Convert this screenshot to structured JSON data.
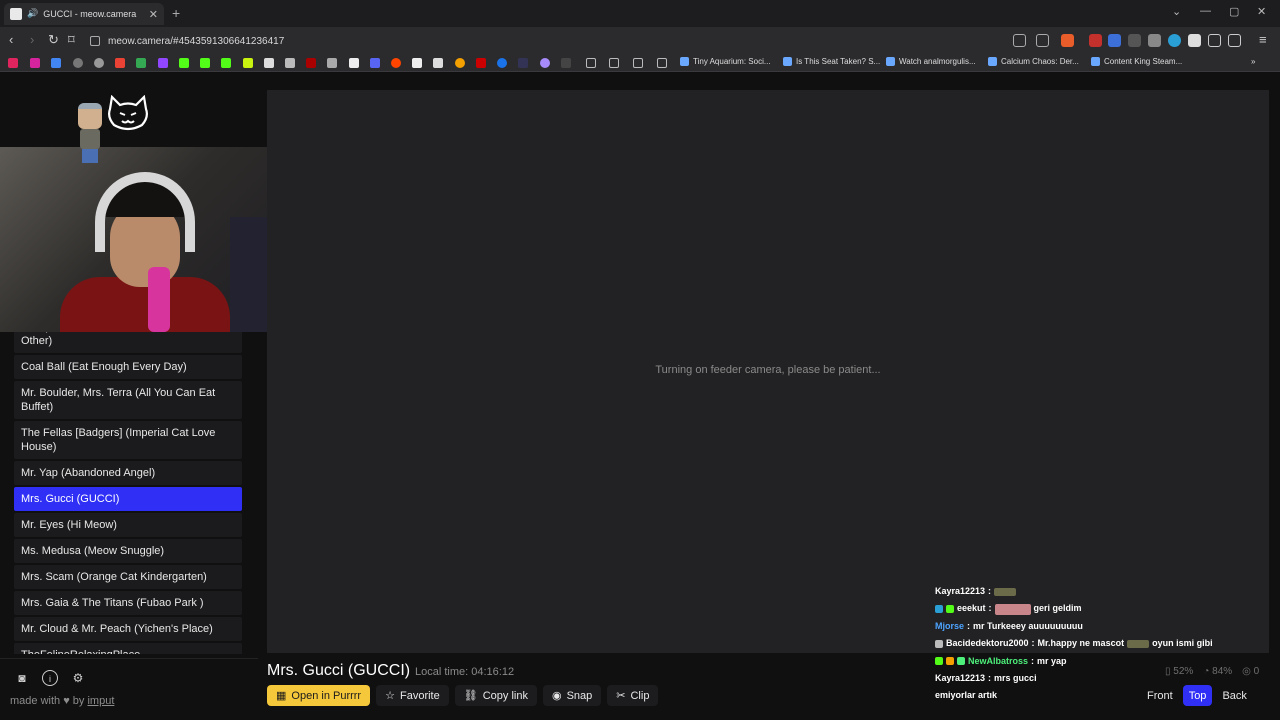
{
  "browser": {
    "tab_title": "GUCCI - meow.camera",
    "url": "meow.camera/#4543591306641236417",
    "bookmarks": [
      {
        "label": "Tiny Aquarium: Soci..."
      },
      {
        "label": "Is This Seat Taken? S..."
      },
      {
        "label": "Watch analmorgulis..."
      },
      {
        "label": "Calcium Chaos: Der..."
      },
      {
        "label": "Content King Steam..."
      }
    ]
  },
  "sidebar": {
    "cameras": [
      {
        "label": "Bob (Harbor Of Cats Who Love Each Other)",
        "partial_top": true
      },
      {
        "label": "Coal Ball (Eat Enough Every Day)"
      },
      {
        "label": "Mr. Boulder, Mrs. Terra (All You Can Eat Buffet)"
      },
      {
        "label": "The Fellas [Badgers] (Imperial Cat Love House)"
      },
      {
        "label": "Mr. Yap (Abandoned Angel)"
      },
      {
        "label": "Mrs. Gucci (GUCCI)",
        "active": true
      },
      {
        "label": "Mr. Eyes (Hi Meow)"
      },
      {
        "label": "Ms. Medusa (Meow Snuggle)"
      },
      {
        "label": "Mrs. Scam (Orange Cat Kindergarten)"
      },
      {
        "label": "Mrs. Gaia & The Titans (Fubao Park )"
      },
      {
        "label": "Mr. Cloud & Mr. Peach (Yichen's Place)"
      },
      {
        "label": "TheFelineRelaxingPlace"
      }
    ],
    "footer": {
      "made_with": "made with",
      "by": "by",
      "author": "imput"
    }
  },
  "player": {
    "status_message": "Turning on feeder camera, please be patient..."
  },
  "camera_info": {
    "title": "Mrs. Gucci (GUCCI)",
    "local_time": "Local time: 04:16:12"
  },
  "actions": {
    "open_label": "Open in Purrrr",
    "favorite_label": "Favorite",
    "copy_label": "Copy link",
    "snap_label": "Snap",
    "clip_label": "Clip"
  },
  "view": {
    "front_label": "Front",
    "top_label": "Top",
    "back_label": "Back",
    "active": "Top"
  },
  "stats": {
    "storage": "52%",
    "food": "84%",
    "viewers": "0"
  },
  "chat": [
    {
      "user": "Kayra12213",
      "text": ""
    },
    {
      "user": "eeekut",
      "text": "geri geldim"
    },
    {
      "user": "Mjorse",
      "text": "mr Turkeeey auuuuuuuuu"
    },
    {
      "user": "Bacidedektoru2000",
      "text": "Mr.happy ne mascot",
      "text2": "oyun ismi gibi"
    },
    {
      "user": "NewAlbatross",
      "text": "mr yap"
    },
    {
      "user": "Kayra12213",
      "text": "mrs gucci"
    },
    {
      "user": "",
      "text": "emiyorlar artık"
    }
  ],
  "colors": {
    "accent": "#2f2ff5",
    "open_button": "#f5c73b"
  }
}
